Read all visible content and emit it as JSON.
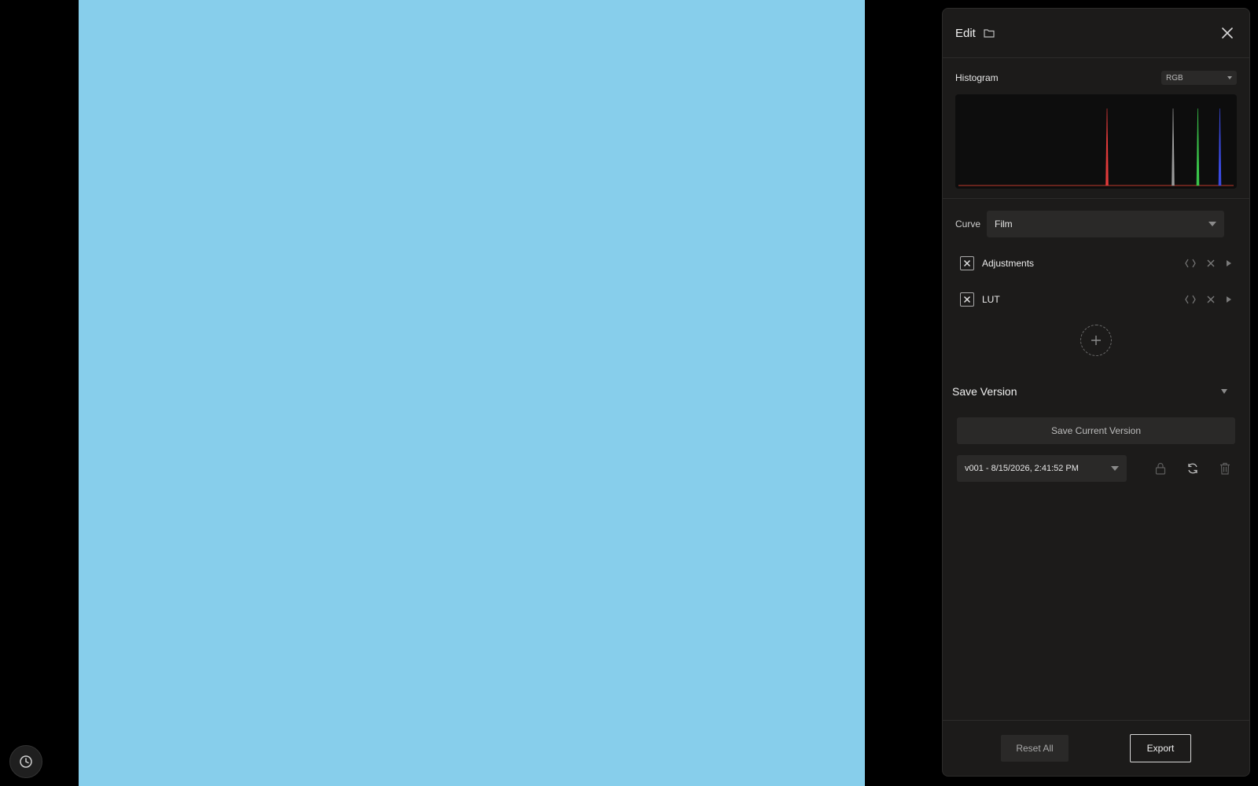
{
  "panel": {
    "title": "Edit",
    "folder_icon": "folder-icon",
    "close_icon": "close-icon"
  },
  "histogram": {
    "label": "Histogram",
    "mode": "RGB",
    "peaks": [
      {
        "channel": "red",
        "color": "#e03a3a",
        "position": 0.54
      },
      {
        "channel": "luma",
        "color": "#9a9a9a",
        "position": 0.78
      },
      {
        "channel": "green",
        "color": "#3ac44a",
        "position": 0.87
      },
      {
        "channel": "blue",
        "color": "#3a4ae0",
        "position": 0.95
      }
    ]
  },
  "curve": {
    "label": "Curve",
    "value": "Film"
  },
  "layers": [
    {
      "name": "Adjustments",
      "enabled": true
    },
    {
      "name": "LUT",
      "enabled": true
    }
  ],
  "add_layer_icon": "plus-icon",
  "versions": {
    "title": "Save Version",
    "save_current_label": "Save Current Version",
    "selected": "v001 - 8/15/2026, 2:41:52 PM",
    "icons": [
      "lock-icon",
      "refresh-icon",
      "trash-icon"
    ]
  },
  "footer": {
    "reset_label": "Reset All",
    "export_label": "Export"
  },
  "history_icon": "clock-icon",
  "colors": {
    "preview": "#87ceeb",
    "panel_bg": "#1c1b1a"
  }
}
